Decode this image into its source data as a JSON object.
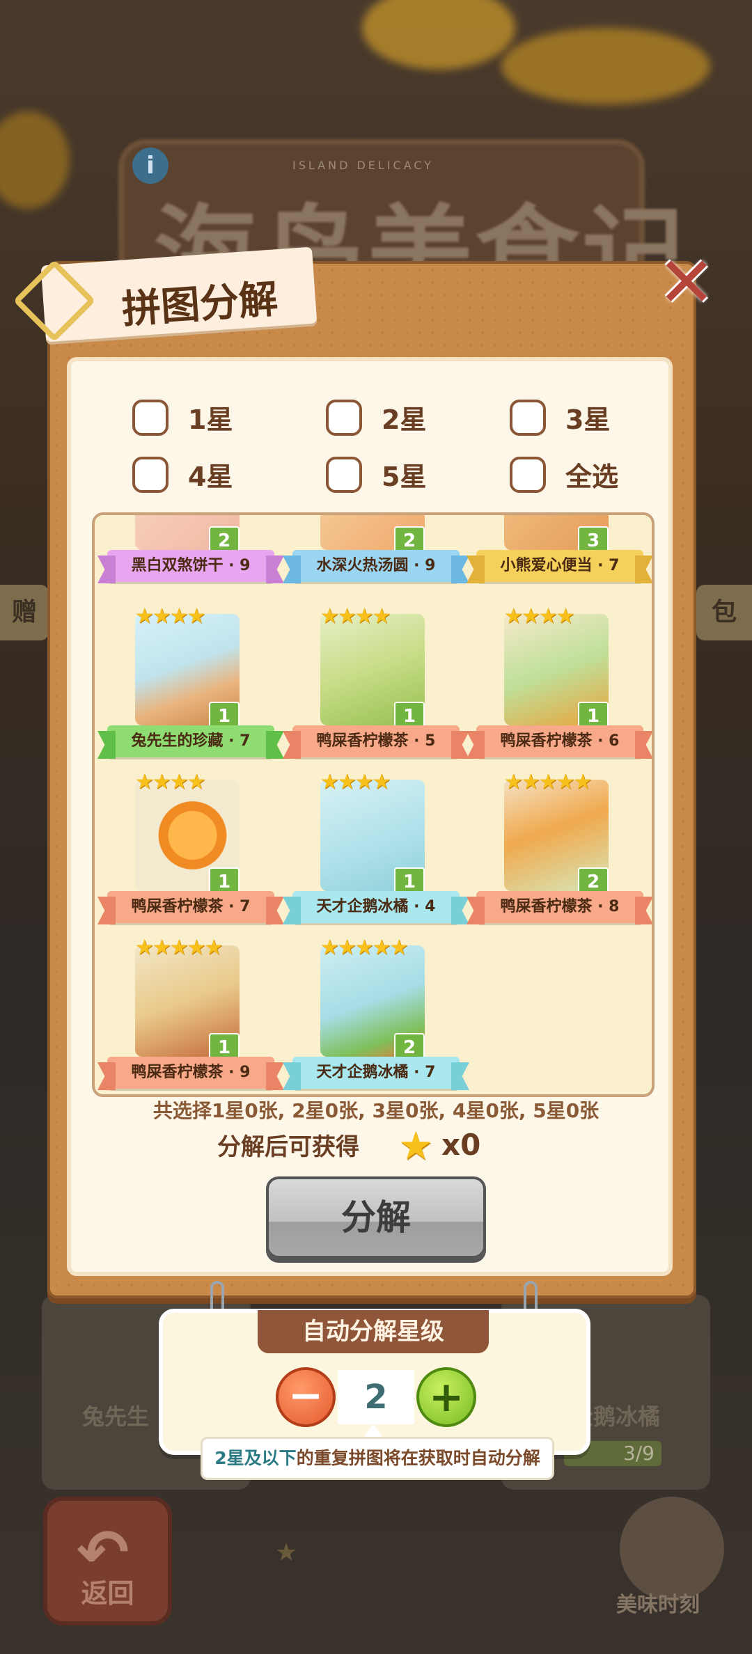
{
  "background": {
    "title": "海岛美食记",
    "subtitle": "ISLAND DELICACY",
    "info_icon": "i",
    "left_tab": "赠",
    "right_tab": "包",
    "card_left_label": "兔先生",
    "card_right_label": "企鹅冰橘",
    "progress": "3/9",
    "back_label": "返回",
    "deco_label": "美味时刻"
  },
  "dialog": {
    "title": "拼图分解",
    "close_icon": "✕",
    "filters": [
      {
        "label": "1星",
        "checked": false
      },
      {
        "label": "2星",
        "checked": false
      },
      {
        "label": "3星",
        "checked": false
      },
      {
        "label": "4星",
        "checked": false
      },
      {
        "label": "5星",
        "checked": false
      },
      {
        "label": "全选",
        "checked": false
      }
    ],
    "cards": [
      {
        "name": "黑白双煞饼干 · 9",
        "count": "2",
        "stars": "",
        "ribbon": "purple"
      },
      {
        "name": "水深火热汤圆 · 9",
        "count": "2",
        "stars": "",
        "ribbon": "blue"
      },
      {
        "name": "小熊爱心便当 · 7",
        "count": "3",
        "stars": "",
        "ribbon": "yellow"
      },
      {
        "name": "兔先生的珍藏 · 7",
        "count": "1",
        "stars": "★★★★",
        "ribbon": "green"
      },
      {
        "name": "鸭屎香柠檬茶 · 5",
        "count": "1",
        "stars": "★★★★",
        "ribbon": "orange"
      },
      {
        "name": "鸭屎香柠檬茶 · 6",
        "count": "1",
        "stars": "★★★★",
        "ribbon": "orange"
      },
      {
        "name": "鸭屎香柠檬茶 · 7",
        "count": "1",
        "stars": "★★★★",
        "ribbon": "orange"
      },
      {
        "name": "天才企鹅冰橘 · 4",
        "count": "1",
        "stars": "★★★★",
        "ribbon": "cyan"
      },
      {
        "name": "鸭屎香柠檬茶 · 8",
        "count": "2",
        "stars": "★★★★★",
        "ribbon": "orange"
      },
      {
        "name": "鸭屎香柠檬茶 · 9",
        "count": "1",
        "stars": "★★★★★",
        "ribbon": "orange"
      },
      {
        "name": "天才企鹅冰橘 · 7",
        "count": "2",
        "stars": "★★★★★",
        "ribbon": "cyan"
      }
    ],
    "summary": "共选择1星0张, 2星0张, 3星0张, 4星0张, 5星0张",
    "gain_label": "分解后可获得",
    "gain_star": "★",
    "gain_count": "x0",
    "decompose_button": "分解"
  },
  "auto": {
    "title": "自动分解星级",
    "minus": "−",
    "plus": "+",
    "level": "2",
    "tip_highlight": "2星及以下",
    "tip_rest": "的重复拼图将在获取时自动分解"
  },
  "colors": {
    "panel": "#c98a4a",
    "inner": "#fdf7ea",
    "title_text": "#5a3216",
    "count_badge": "#72b540",
    "star": "#f7c01a"
  }
}
